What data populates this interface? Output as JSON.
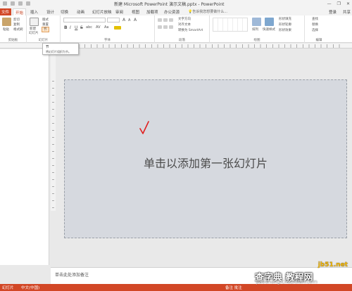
{
  "window": {
    "title": "新建 Microsoft PowerPoint 演示文稿.pptx - PowerPoint",
    "minimize_glyph": "—",
    "restore_glyph": "❐",
    "close_glyph": "✕"
  },
  "tabs": {
    "file": "文件",
    "home": "开始",
    "insert": "插入",
    "design": "设计",
    "transitions": "切换",
    "animations": "动画",
    "slideshow": "幻灯片放映",
    "review": "审阅",
    "view": "视图",
    "addins": "加载项",
    "office_tab": "办公资源",
    "tell_me": "告诉我您想要做什么...",
    "sign_in": "登录",
    "share": "共享"
  },
  "ribbon": {
    "clipboard": {
      "paste": "粘贴",
      "cut": "剪切",
      "copy": "复制",
      "format_painter": "格式刷",
      "label": "剪贴板"
    },
    "slides": {
      "new_slide": "新建",
      "new_slide_line2": "幻灯片",
      "layout": "版式",
      "reset": "重置",
      "section": "节",
      "label": "幻灯片"
    },
    "font": {
      "label": "字体",
      "bold": "B",
      "italic": "I",
      "underline": "U",
      "strike": "S",
      "shadow": "abc",
      "spacing": "AV",
      "case": "Aa",
      "grow": "A",
      "shrink": "A",
      "clear": "A"
    },
    "paragraph": {
      "label": "段落",
      "text_direction": "文字方向",
      "align_text": "对齐文本",
      "smartart": "转换为 SmartArt"
    },
    "drawing": {
      "label": "绘图",
      "arrange": "排列",
      "quick_styles": "快速样式",
      "fill": "形状填充",
      "outline": "形状轮廓",
      "effects": "形状效果"
    },
    "editing": {
      "label": "编辑",
      "find": "查找",
      "replace": "替换",
      "select": "选择"
    }
  },
  "tooltip": {
    "title": "节",
    "description": "将幻灯片组织为节。"
  },
  "slide": {
    "placeholder": "单击以添加第一张幻灯片"
  },
  "notes": {
    "label": "单击此处添加备注"
  },
  "status": {
    "slide": "幻灯片",
    "language": "中文(中国)",
    "right": "备注  批注"
  },
  "watermark": {
    "main": "查字典 教程网",
    "site": "jb51.net",
    "url": "jiaocheng.chazidian.com"
  },
  "colors": {
    "accent": "#d24726",
    "slide_bg": "#d6d9df",
    "check": "#e02020"
  }
}
